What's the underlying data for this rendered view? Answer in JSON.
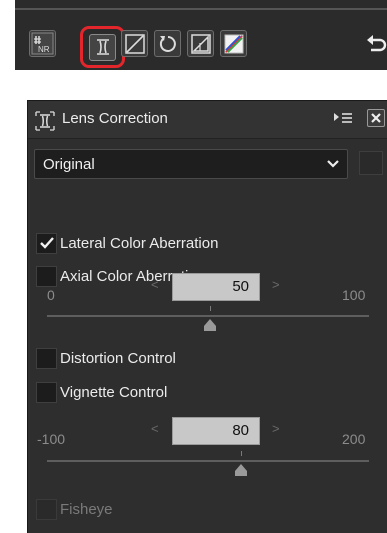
{
  "toolbar": {
    "tools": [
      {
        "name": "NR",
        "icon": "noise-reduction-icon"
      },
      {
        "name": "Lens Correction",
        "icon": "lens-correction-icon",
        "selected": true
      },
      {
        "name": "Levels",
        "icon": "levels-icon"
      },
      {
        "name": "Rotate",
        "icon": "rotate-icon"
      },
      {
        "name": "Perspective",
        "icon": "perspective-icon"
      },
      {
        "name": "Color Curve",
        "icon": "color-curve-icon"
      }
    ],
    "undo_icon": "undo-icon",
    "highlight_color": "#e2262b"
  },
  "panel": {
    "title": "Lens Correction",
    "dropdown": {
      "selected": "Original"
    },
    "lateral_color_aberration": {
      "label": "Lateral Color Aberration",
      "checked": true
    },
    "axial_color_aberration": {
      "label": "Axial Color Aberration",
      "checked": false,
      "min_label": "0",
      "max_label": "100",
      "value": "50"
    },
    "distortion_control": {
      "label": "Distortion Control",
      "checked": false
    },
    "vignette_control": {
      "label": "Vignette Control",
      "checked": false,
      "min_label": "-100",
      "max_label": "200",
      "value": "80"
    },
    "fisheye": {
      "label": "Fisheye",
      "checked": false,
      "enabled": false
    }
  }
}
